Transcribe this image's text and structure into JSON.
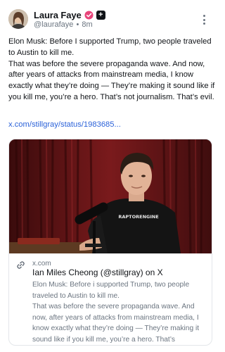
{
  "author": {
    "name": "Laura Faye",
    "handle": "@laurafaye",
    "separator": "•",
    "time": "8m"
  },
  "post": {
    "lines": [
      "Elon Musk: Before I supported Trump, two people traveled to Austin to kill me.",
      "That was before the severe propaganda wave. And now, after years of attacks from mainstream media, I know exactly what they’re doing — They’re making it sound like if you kill me, you’re a hero. That’s not journalism. That’s evil."
    ],
    "link": "x.com/stillgray/status/1983685..."
  },
  "card": {
    "domain": "x.com",
    "title": "Ian Miles Cheong (@stillgray) on X",
    "description_lines": [
      "Elon Musk: Before i supported Trump, two people traveled to Austin to kill me.",
      "That was before the severe propaganda wave. And now, after years of attacks from mainstream media, I know exactly what they’re doing — They’re making it sound like if you kill me, you’re a hero. That’s"
    ],
    "image_shirt_text": "RAPTORENGINE"
  },
  "icons": {
    "verified": "verified-badge-icon",
    "plus": "plus-badge-icon",
    "more": "more-vertical-icon",
    "link": "link-icon"
  },
  "colors": {
    "verified_badge": "#e8447a",
    "link": "#2b62d9",
    "muted_text": "#6b7580"
  }
}
